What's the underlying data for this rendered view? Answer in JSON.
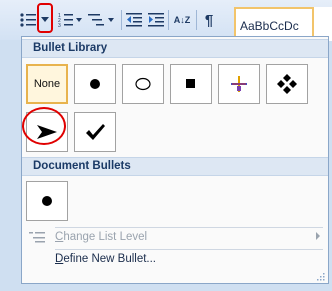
{
  "ribbon": {
    "style_preview": "AaBbCcDc",
    "sort_label": "A↓Z",
    "pilcrow": "¶"
  },
  "menu": {
    "bullet_library_title": "Bullet Library",
    "document_bullets_title": "Document Bullets",
    "none_label": "None",
    "library_bullets": [
      {
        "name": "filled-circle",
        "glyph": "●"
      },
      {
        "name": "hollow-circle",
        "glyph": "○"
      },
      {
        "name": "filled-square",
        "glyph": "■"
      },
      {
        "name": "four-diamonds",
        "glyph": "❖"
      },
      {
        "name": "arrowhead",
        "glyph": "➤"
      },
      {
        "name": "checkmark",
        "glyph": "✔"
      }
    ],
    "document_bullet": {
      "name": "filled-circle",
      "glyph": "●"
    },
    "change_list_level": "Change List Level",
    "define_new_bullet": "Define New Bullet..."
  },
  "colors": {
    "highlight_red": "#e00000",
    "selected_border": "#e8b34e"
  }
}
